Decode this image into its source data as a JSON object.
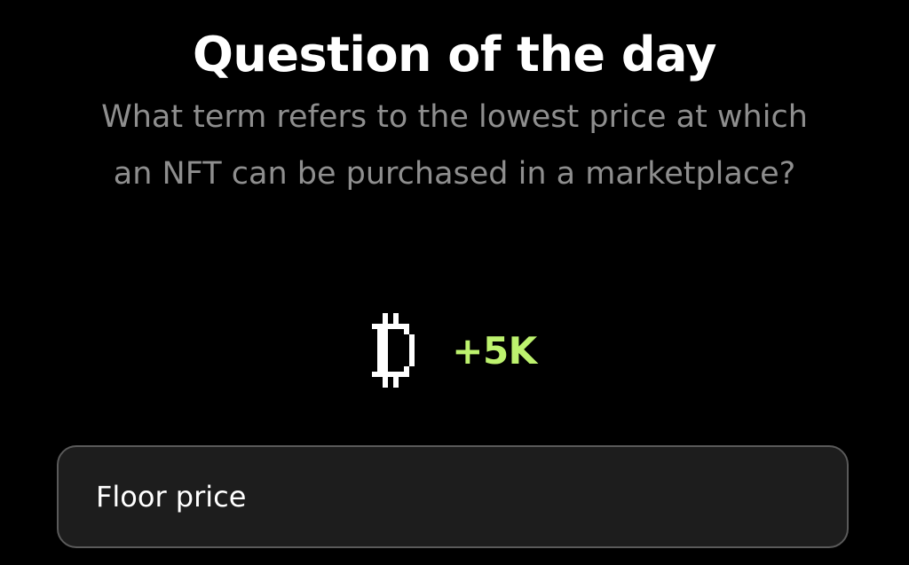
{
  "header": {
    "title": "Question of the day"
  },
  "quiz": {
    "question": "What term refers to the lowest price at which an NFT can be purchased in a marketplace?",
    "reward": {
      "icon": "pixel-coin-icon",
      "amount": "+5K",
      "color": "#bdf26e"
    },
    "options": [
      {
        "label": "Floor price"
      }
    ]
  },
  "colors": {
    "background": "#000000",
    "title": "#ffffff",
    "question": "#8e8e8e",
    "option_background": "#1d1d1d",
    "option_border": "#5a5a5a"
  }
}
